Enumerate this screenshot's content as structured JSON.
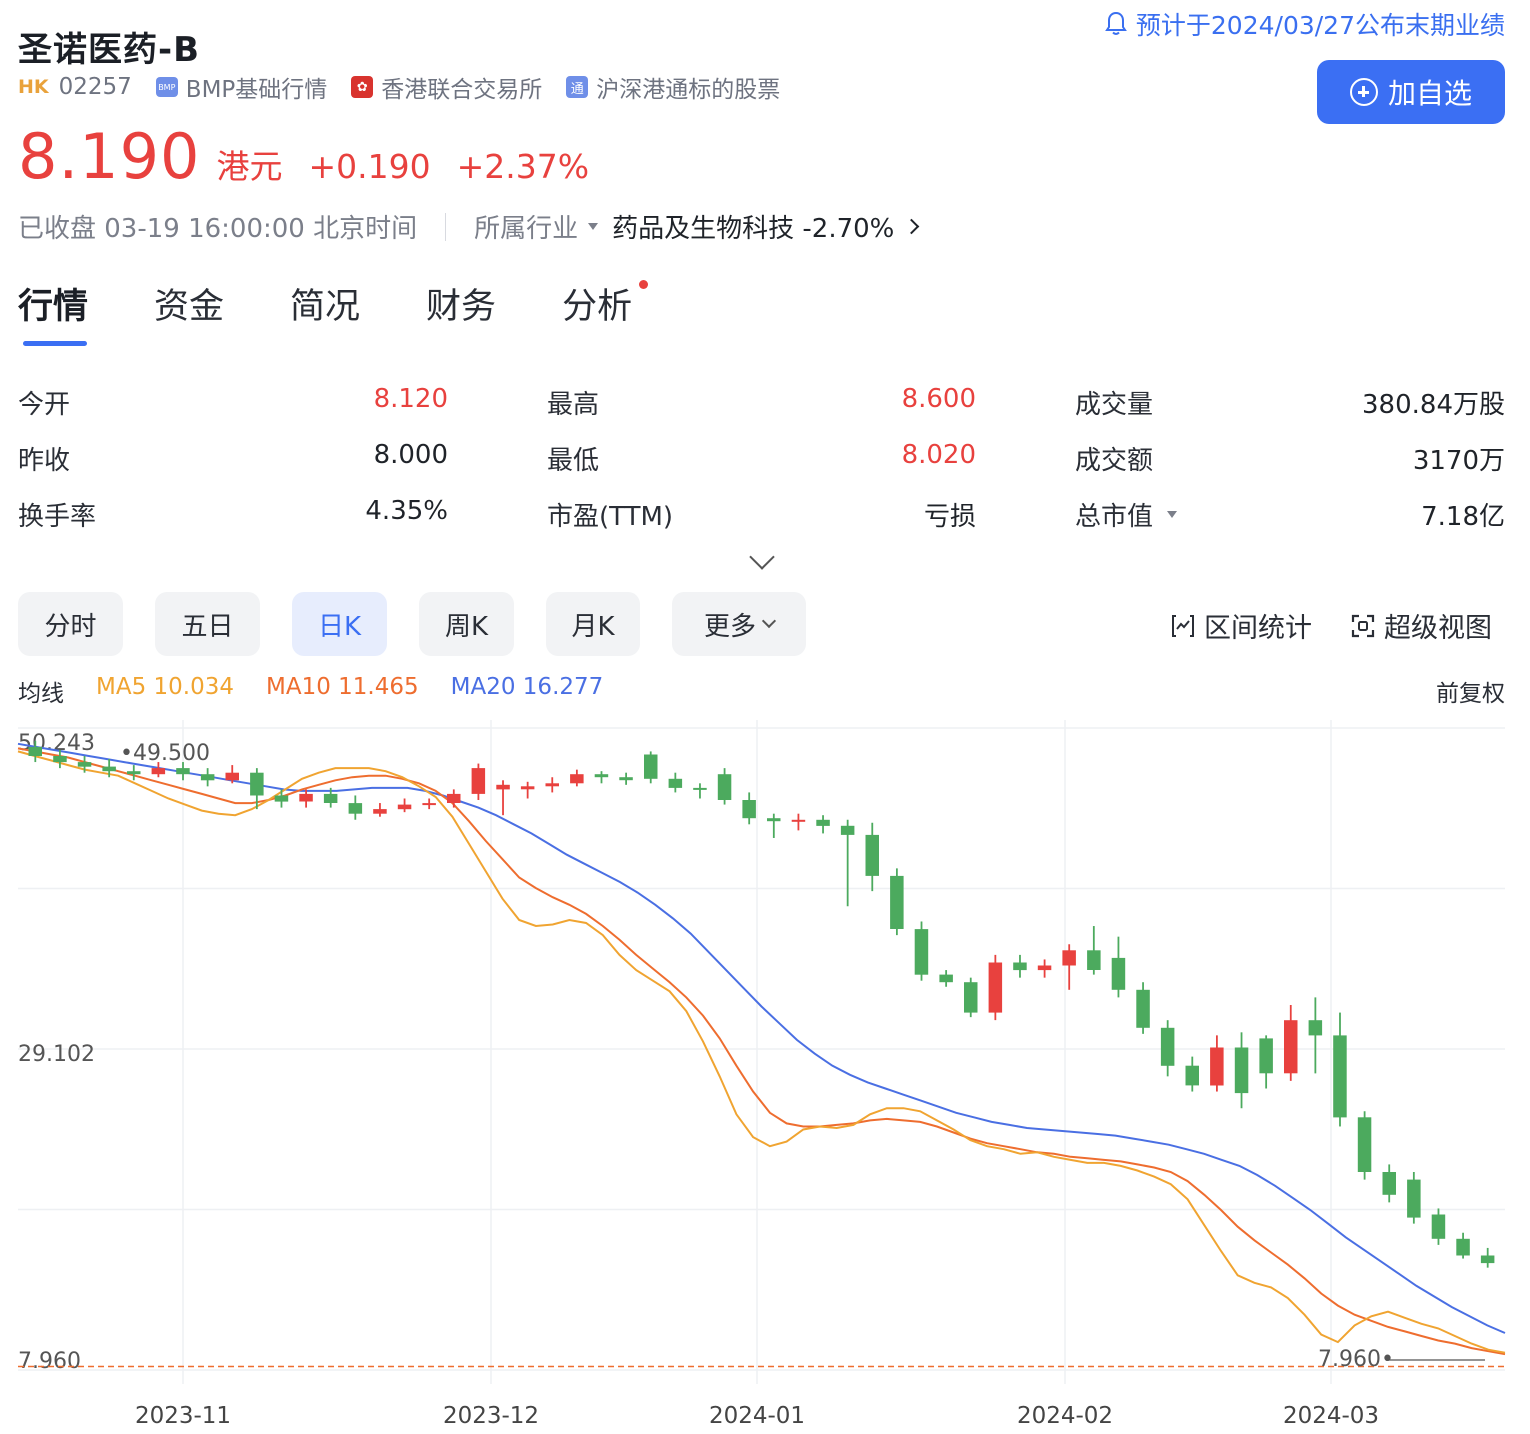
{
  "header": {
    "name": "圣诺医药-B",
    "notice": "预计于2024/03/27公布末期业绩",
    "market": "HK",
    "code": "02257",
    "bmp_badge": "BMP",
    "bmp": "BMP基础行情",
    "exchange": "香港联合交易所",
    "connect_badge": "通",
    "connect": "沪深港通标的股票",
    "add_button": "加自选"
  },
  "quote": {
    "price": "8.190",
    "currency": "港元",
    "change": "+0.190",
    "change_pct": "+2.37%",
    "status": "已收盘 03-19 16:00:00 北京时间",
    "industry_label": "所属行业",
    "industry": "药品及生物科技 -2.70%"
  },
  "tabs": [
    {
      "label": "行情"
    },
    {
      "label": "资金"
    },
    {
      "label": "简况"
    },
    {
      "label": "财务"
    },
    {
      "label": "分析"
    }
  ],
  "stats": {
    "open_label": "今开",
    "open": "8.120",
    "high_label": "最高",
    "high": "8.600",
    "volume_label": "成交量",
    "volume": "380.84万股",
    "prev_close_label": "昨收",
    "prev_close": "8.000",
    "low_label": "最低",
    "low": "8.020",
    "turnover_label": "成交额",
    "turnover": "3170万",
    "turnover_rate_label": "换手率",
    "turnover_rate": "4.35%",
    "pe_label": "市盈(TTM)",
    "pe": "亏损",
    "market_cap_label": "总市值",
    "market_cap": "7.18亿"
  },
  "periods": [
    "分时",
    "五日",
    "日K",
    "周K",
    "月K",
    "更多"
  ],
  "active_period": "日K",
  "tools": {
    "range_stats": "区间统计",
    "super_view": "超级视图"
  },
  "ma": {
    "label": "均线",
    "ma5": "MA5 10.034",
    "ma10": "MA10 11.465",
    "ma20": "MA20 16.277",
    "adjust": "前复权"
  },
  "colors": {
    "up": "#e8413e",
    "down": "#4caa5e",
    "ma5": "#f0a431",
    "ma10": "#ee6d2f",
    "ma20": "#4a6fe3",
    "accent": "#3b6ff3"
  },
  "chart_data": {
    "type": "candlestick",
    "y_axis_labels": [
      "50.243",
      "29.102",
      "7.960"
    ],
    "x_axis_labels": [
      "2023-11",
      "2023-12",
      "2024-01",
      "2024-02",
      "2024-03"
    ],
    "max_label": "49.500",
    "min_label": "7.960",
    "last_price_line": 8.19,
    "ylim": [
      7.96,
      50.243
    ],
    "ma5": [
      48.7,
      48.4,
      48.1,
      47.8,
      47.5,
      47.3,
      47.1,
      46.6,
      46.1,
      45.6,
      45.2,
      44.8,
      44.6,
      44.5,
      44.9,
      45.5,
      46.2,
      46.9,
      47.3,
      47.6,
      47.6,
      47.6,
      47.4,
      47.0,
      46.4,
      45.7,
      44.4,
      42.6,
      40.8,
      39.0,
      37.6,
      37.2,
      37.3,
      37.6,
      37.4,
      36.6,
      35.3,
      34.3,
      33.6,
      32.9,
      31.6,
      29.6,
      27.3,
      24.8,
      23.3,
      22.7,
      23.0,
      23.8,
      24.0,
      23.9,
      24.1,
      24.8,
      25.2,
      25.2,
      25.0,
      24.4,
      23.8,
      23.1,
      22.7,
      22.5,
      22.2,
      22.3,
      22.0,
      21.8,
      21.6,
      21.6,
      21.4,
      21.1,
      20.7,
      20.2,
      19.2,
      17.5,
      15.8,
      14.2,
      13.7,
      13.4,
      12.7,
      11.6,
      10.3,
      9.8,
      10.9,
      11.5,
      11.8,
      11.4,
      11.0,
      10.7,
      10.2,
      9.7,
      9.3,
      9.1
    ],
    "ma10": [
      48.9,
      48.7,
      48.5,
      48.3,
      48.0,
      47.7,
      47.4,
      47.1,
      46.8,
      46.5,
      46.2,
      45.9,
      45.6,
      45.3,
      45.3,
      45.5,
      45.8,
      46.2,
      46.5,
      46.8,
      47.0,
      47.1,
      47.1,
      46.9,
      46.6,
      46.1,
      45.3,
      44.1,
      42.8,
      41.6,
      40.4,
      39.7,
      39.1,
      38.6,
      38.0,
      37.2,
      36.3,
      35.3,
      34.4,
      33.5,
      32.5,
      31.3,
      29.8,
      28.0,
      26.3,
      24.9,
      24.2,
      24.0,
      24.0,
      24.1,
      24.2,
      24.4,
      24.5,
      24.4,
      24.3,
      24.0,
      23.6,
      23.2,
      22.9,
      22.7,
      22.5,
      22.3,
      22.2,
      22.0,
      21.9,
      21.8,
      21.7,
      21.5,
      21.3,
      21.0,
      20.4,
      19.5,
      18.5,
      17.4,
      16.5,
      15.7,
      14.9,
      14.0,
      13.0,
      12.2,
      11.6,
      11.2,
      10.8,
      10.5,
      10.2,
      9.9,
      9.7,
      9.4,
      9.2,
      9.0
    ],
    "ma20": [
      49.2,
      49.0,
      48.8,
      48.6,
      48.4,
      48.2,
      48.0,
      47.8,
      47.6,
      47.4,
      47.2,
      47.0,
      46.8,
      46.6,
      46.4,
      46.2,
      46.1,
      46.1,
      46.1,
      46.2,
      46.3,
      46.3,
      46.3,
      46.1,
      45.8,
      45.4,
      45.0,
      44.5,
      43.9,
      43.3,
      42.6,
      41.9,
      41.3,
      40.7,
      40.1,
      39.4,
      38.6,
      37.7,
      36.7,
      35.5,
      34.3,
      33.1,
      31.9,
      30.8,
      29.7,
      28.8,
      28.0,
      27.4,
      26.9,
      26.5,
      26.1,
      25.7,
      25.3,
      24.9,
      24.6,
      24.3,
      24.1,
      23.9,
      23.8,
      23.7,
      23.6,
      23.5,
      23.4,
      23.2,
      23.0,
      22.8,
      22.5,
      22.2,
      21.8,
      21.4,
      20.8,
      20.1,
      19.3,
      18.5,
      17.6,
      16.7,
      15.9,
      15.1,
      14.3,
      13.5,
      12.8,
      12.1,
      11.5,
      10.9,
      10.4
    ],
    "candles": [
      [
        49.0,
        48.4,
        49.4,
        48.0
      ],
      [
        48.4,
        48.0,
        48.8,
        47.6
      ],
      [
        48.0,
        47.7,
        48.4,
        47.3
      ],
      [
        47.7,
        47.4,
        48.2,
        47.0
      ],
      [
        47.4,
        47.2,
        47.8,
        46.8
      ],
      [
        47.2,
        47.6,
        48.0,
        47.0
      ],
      [
        47.6,
        47.2,
        48.0,
        46.8
      ],
      [
        47.2,
        46.8,
        47.6,
        46.4
      ],
      [
        46.8,
        47.3,
        47.8,
        46.6
      ],
      [
        47.3,
        45.8,
        47.6,
        44.9
      ],
      [
        45.8,
        45.4,
        46.2,
        45.0
      ],
      [
        45.4,
        45.9,
        46.2,
        45.0
      ],
      [
        45.9,
        45.3,
        46.3,
        45.0
      ],
      [
        45.3,
        44.6,
        45.8,
        44.2
      ],
      [
        44.6,
        44.9,
        45.3,
        44.4
      ],
      [
        44.9,
        45.2,
        45.6,
        44.7
      ],
      [
        45.2,
        45.3,
        45.6,
        44.9
      ],
      [
        45.3,
        45.9,
        46.2,
        45.0
      ],
      [
        45.9,
        47.6,
        47.9,
        45.5
      ],
      [
        46.2,
        46.5,
        46.8,
        44.5
      ],
      [
        46.2,
        46.4,
        46.7,
        45.6
      ],
      [
        46.4,
        46.6,
        47.0,
        46.0
      ],
      [
        46.6,
        47.2,
        47.5,
        46.4
      ],
      [
        47.2,
        47.0,
        47.4,
        46.6
      ],
      [
        47.0,
        46.8,
        47.3,
        46.5
      ],
      [
        48.5,
        46.9,
        48.7,
        46.6
      ],
      [
        46.9,
        46.3,
        47.3,
        46.0
      ],
      [
        46.3,
        46.2,
        46.6,
        45.6
      ],
      [
        47.2,
        45.5,
        47.6,
        45.2
      ],
      [
        45.5,
        44.3,
        46.0,
        43.9
      ],
      [
        44.3,
        44.1,
        44.6,
        43.0
      ],
      [
        44.1,
        44.2,
        44.6,
        43.5
      ],
      [
        44.2,
        43.8,
        44.5,
        43.3
      ],
      [
        43.8,
        43.2,
        44.2,
        38.5
      ],
      [
        43.2,
        40.5,
        44.0,
        39.5
      ],
      [
        40.5,
        37.0,
        41.0,
        36.6
      ],
      [
        37.0,
        34.0,
        37.5,
        33.6
      ],
      [
        34.0,
        33.5,
        34.3,
        33.2
      ],
      [
        33.5,
        31.5,
        33.8,
        31.2
      ],
      [
        31.5,
        34.8,
        35.3,
        31.0
      ],
      [
        34.8,
        34.3,
        35.3,
        33.8
      ],
      [
        34.3,
        34.6,
        35.0,
        33.8
      ],
      [
        34.6,
        35.6,
        36.0,
        33.0
      ],
      [
        35.6,
        34.3,
        37.2,
        34.0
      ],
      [
        35.1,
        33.0,
        36.5,
        32.5
      ],
      [
        33.0,
        30.5,
        33.5,
        30.1
      ],
      [
        30.5,
        28.0,
        31.0,
        27.3
      ],
      [
        28.0,
        26.7,
        28.6,
        26.3
      ],
      [
        26.7,
        29.2,
        30.0,
        26.3
      ],
      [
        29.2,
        26.2,
        30.2,
        25.2
      ],
      [
        29.8,
        27.5,
        30.0,
        26.5
      ],
      [
        27.5,
        31.0,
        32.0,
        27.0
      ],
      [
        31.0,
        30.0,
        32.5,
        27.5
      ],
      [
        30.0,
        24.6,
        31.5,
        24.0
      ],
      [
        24.6,
        21.0,
        25.0,
        20.5
      ],
      [
        21.0,
        19.5,
        21.5,
        19.0
      ],
      [
        20.5,
        18.0,
        21.0,
        17.6
      ],
      [
        18.2,
        16.6,
        18.6,
        16.2
      ],
      [
        16.6,
        15.5,
        17.0,
        15.3
      ],
      [
        15.5,
        15.0,
        16.0,
        14.7
      ]
    ]
  }
}
